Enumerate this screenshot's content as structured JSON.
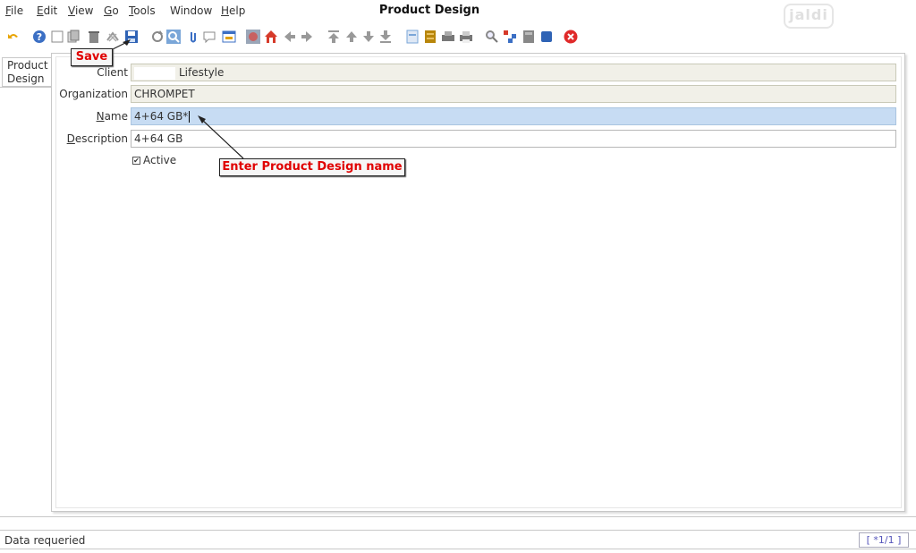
{
  "window": {
    "title": "Product Design",
    "logo_text": "jaldi"
  },
  "menu": {
    "items": [
      {
        "key": "F",
        "rest": "ile"
      },
      {
        "key": "E",
        "rest": "dit"
      },
      {
        "key": "V",
        "rest": "iew"
      },
      {
        "key": "G",
        "rest": "o"
      },
      {
        "key": "T",
        "rest": "ools"
      },
      {
        "key": "",
        "rest": "Window"
      },
      {
        "key": "H",
        "rest": "elp"
      }
    ]
  },
  "toolbar": {
    "icons": [
      "undo-icon",
      "help-icon",
      "new-icon",
      "copy-icon",
      "delete-icon",
      "delete-selection-icon",
      "save-icon",
      "refresh-icon",
      "find-icon",
      "attachment-icon",
      "chat-icon",
      "grid-toggle-icon",
      "history-icon",
      "home-icon",
      "back-icon",
      "forward-icon",
      "first-record-icon",
      "previous-record-icon",
      "next-record-icon",
      "last-record-icon",
      "report-icon",
      "archive-icon",
      "print-preview-icon",
      "print-icon",
      "zoom-across-icon",
      "request-icon",
      "product-info-icon",
      "workflow-icon",
      "close-window-icon"
    ]
  },
  "tab": {
    "label_line1": "Product",
    "label_line2": "Design"
  },
  "form": {
    "client_label": "Client",
    "client_value": "Lifestyle",
    "organization_label": "Organization",
    "organization_value": "CHROMPET",
    "name_label_key": "N",
    "name_label_rest": "ame",
    "name_value": "4+64 GB*",
    "description_label_key": "D",
    "description_label_rest": "escription",
    "description_value": "4+64 GB",
    "active_label": "Active",
    "active_checked": true
  },
  "callouts": {
    "save": "Save",
    "name": "Enter Product Design name"
  },
  "status": {
    "message": "Data requeried",
    "record_count": "[ *1/1 ]"
  },
  "colors": {
    "accent_red": "#e00000",
    "selected_field": "#c7dcf3",
    "readonly_field": "#f1f0e8"
  }
}
